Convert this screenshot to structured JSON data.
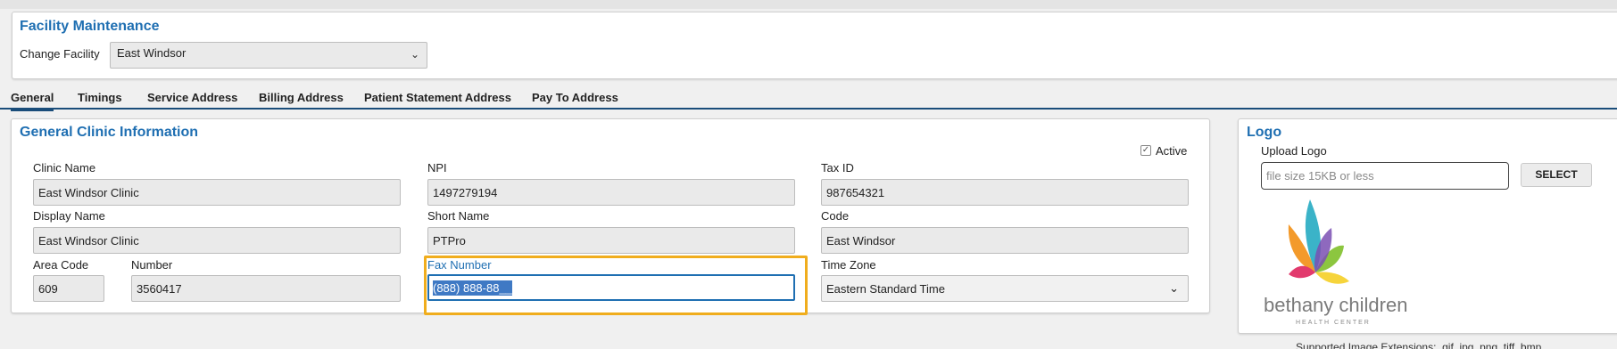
{
  "header": {
    "title": "Facility Maintenance",
    "change_facility_label": "Change Facility",
    "facility_value": "East Windsor"
  },
  "tabs": [
    {
      "label": "General",
      "active": true
    },
    {
      "label": "Timings",
      "active": false
    },
    {
      "label": "Service Address",
      "active": false
    },
    {
      "label": "Billing Address",
      "active": false
    },
    {
      "label": "Patient Statement Address",
      "active": false
    },
    {
      "label": "Pay To Address",
      "active": false
    }
  ],
  "general": {
    "title": "General Clinic Information",
    "active_label": "Active",
    "active_checked": true,
    "clinic_name": {
      "label": "Clinic Name",
      "value": "East Windsor Clinic"
    },
    "npi": {
      "label": "NPI",
      "value": "1497279194"
    },
    "tax_id": {
      "label": "Tax ID",
      "value": "987654321"
    },
    "display_name": {
      "label": "Display Name",
      "value": "East Windsor Clinic"
    },
    "short_name": {
      "label": "Short Name",
      "value": "PTPro"
    },
    "code": {
      "label": "Code",
      "value": "East Windsor"
    },
    "area_code": {
      "label": "Area Code",
      "value": "609"
    },
    "number": {
      "label": "Number",
      "value": "3560417"
    },
    "fax_number": {
      "label": "Fax Number",
      "value": "(888) 888-88__"
    },
    "time_zone": {
      "label": "Time Zone",
      "value": "Eastern Standard Time"
    }
  },
  "logo": {
    "title": "Logo",
    "upload_label": "Upload Logo",
    "upload_placeholder": "file size 15KB or less",
    "select_button": "SELECT",
    "brand_name": "bethany children's",
    "brand_sub": "HEALTH CENTER"
  },
  "footer": {
    "note": "Supported Image Extensions: .gif .jpg .png .tiff .bmp"
  },
  "colors": {
    "accent": "#1f6fb2",
    "highlight": "#f0ad1d"
  }
}
